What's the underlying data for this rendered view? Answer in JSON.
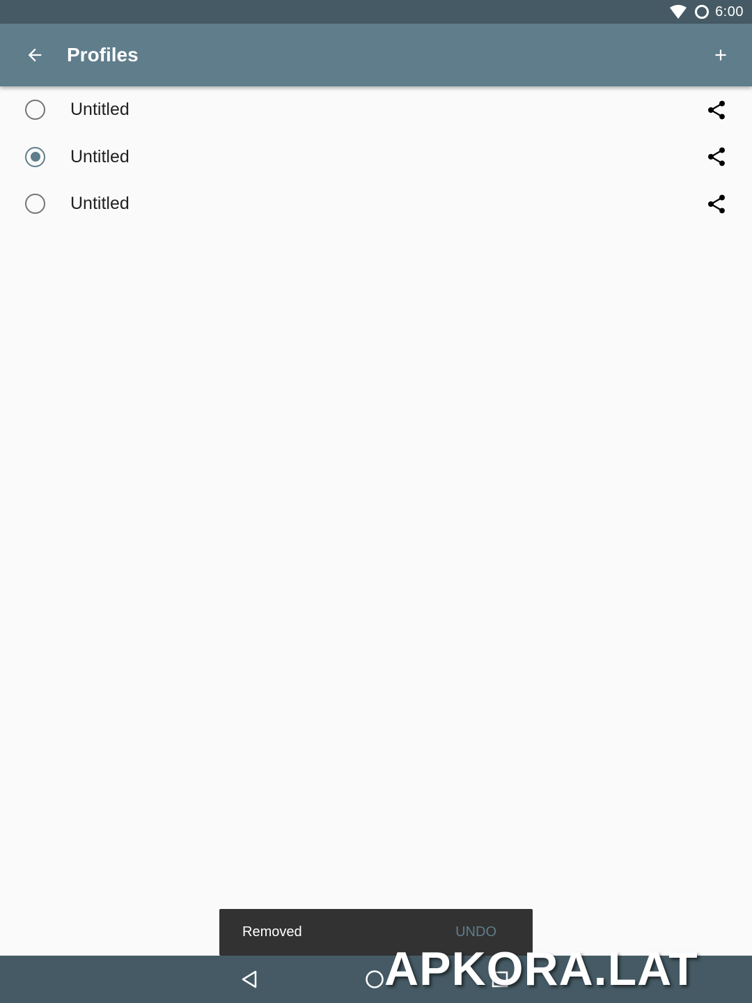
{
  "status_bar": {
    "time": "6:00",
    "icons": [
      "wifi-icon",
      "circle-status-icon"
    ]
  },
  "app_bar": {
    "title": "Profiles",
    "back_icon": "arrow-back-icon",
    "add_icon": "plus-icon",
    "color": "#607d8b"
  },
  "profiles": [
    {
      "label": "Untitled",
      "selected": false
    },
    {
      "label": "Untitled",
      "selected": true
    },
    {
      "label": "Untitled",
      "selected": false
    }
  ],
  "snackbar": {
    "message": "Removed",
    "action": "UNDO"
  },
  "nav_bar": {
    "icons": [
      "nav-back-icon",
      "nav-home-icon",
      "nav-recents-icon"
    ]
  },
  "watermark": "APKORA.LAT",
  "colors": {
    "status_bar": "#455a64",
    "app_bar": "#607d8b",
    "accent": "#607d8b",
    "background": "#fafafa",
    "snackbar": "#323232"
  }
}
